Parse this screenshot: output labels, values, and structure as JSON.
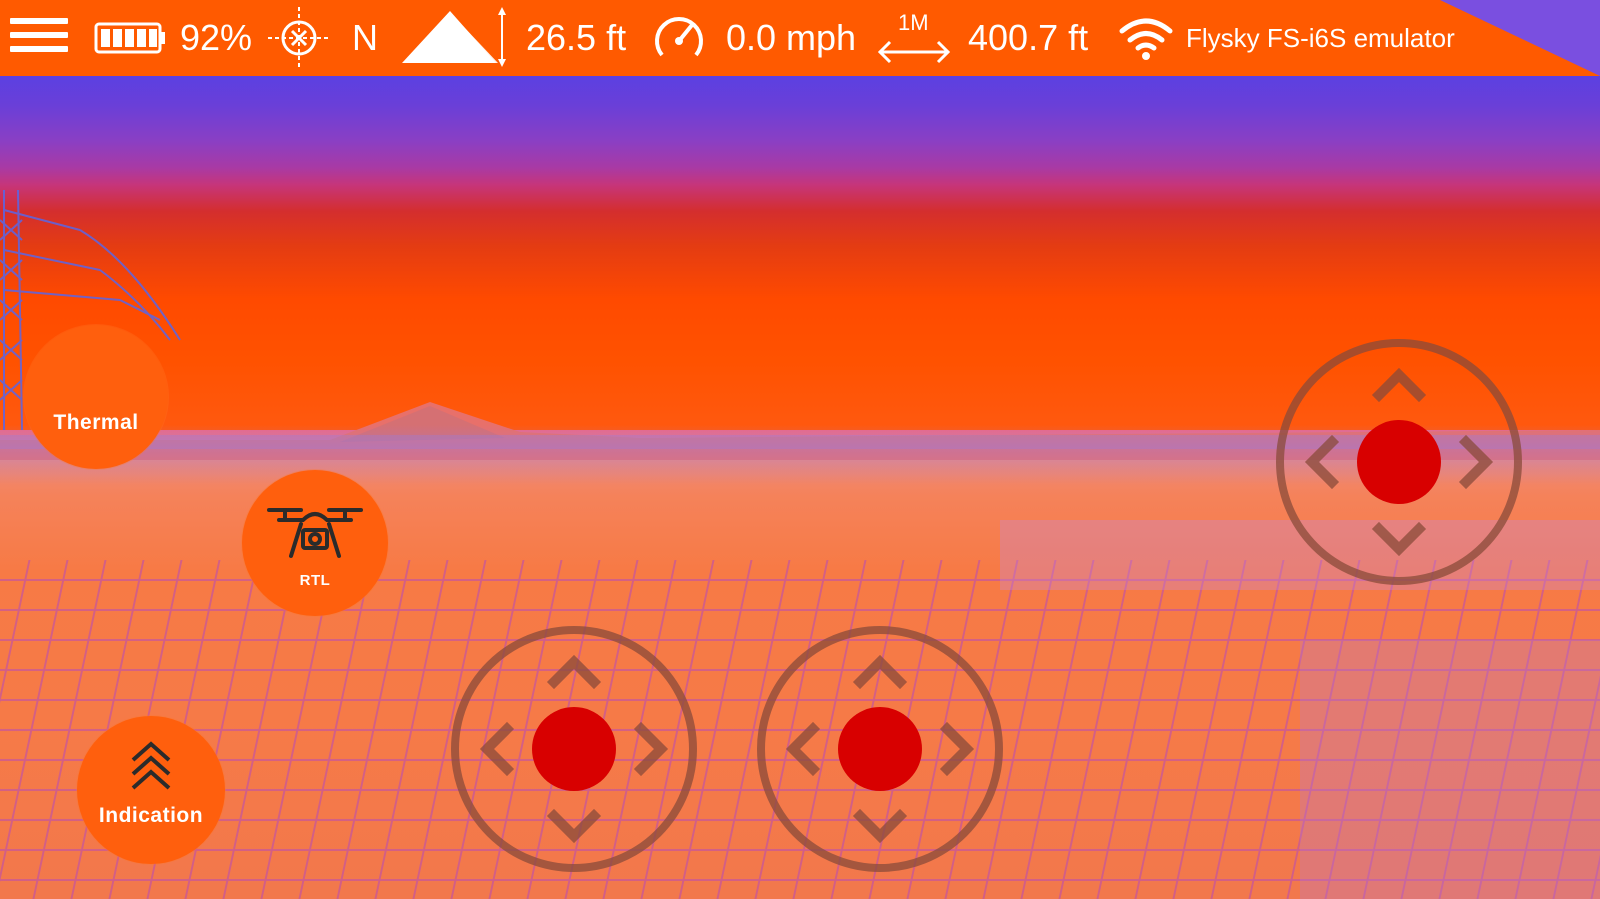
{
  "status_bar": {
    "menu_icon": "hamburger-menu-icon",
    "battery": {
      "icon": "battery-icon",
      "percent_text": "92%",
      "level": 0.92
    },
    "gps": {
      "icon": "gps-crosshair-icon",
      "heading_text": "N"
    },
    "altitude": {
      "icon": "altitude-mountain-icon",
      "value_text": "26.5 ft"
    },
    "speed": {
      "icon": "speedometer-icon",
      "value_text": "0.0 mph"
    },
    "distance": {
      "icon": "distance-arrows-icon",
      "scale_label": "1M",
      "value_text": "400.7 ft"
    },
    "connection": {
      "icon": "wifi-icon",
      "device_name": "Flysky FS-i6S emulator"
    }
  },
  "controls": {
    "thermal_label": "Thermal",
    "rtl_label": "RTL",
    "rtl_icon": "drone-camera-icon",
    "indication_label": "Indication",
    "indication_icon": "chevrons-up-icon"
  },
  "joysticks": {
    "left": {
      "name": "left-joystick"
    },
    "center": {
      "name": "center-joystick"
    },
    "right": {
      "name": "right-joystick"
    }
  },
  "colors": {
    "bar_orange": "#ff5a00",
    "button_orange": "#ff5f0d",
    "stick_red": "#d80000",
    "stick_ring": "#8a4b3a"
  }
}
